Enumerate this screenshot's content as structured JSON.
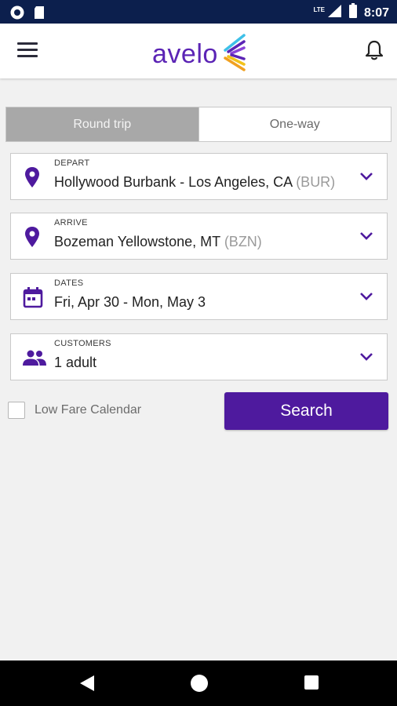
{
  "status_bar": {
    "time": "8:07",
    "network": "LTE",
    "icons": [
      "circle-notification-icon",
      "sd-card-icon",
      "signal-icon",
      "battery-icon"
    ]
  },
  "header": {
    "logo_text": "avelo",
    "icons": [
      "menu-icon",
      "bell-icon"
    ]
  },
  "trip_type": {
    "options": [
      "Round trip",
      "One-way"
    ],
    "selected": "Round trip"
  },
  "fields": {
    "depart": {
      "label": "DEPART",
      "value": "Hollywood Burbank - Los Angeles, CA",
      "code": "(BUR)",
      "icon": "location-pin-icon"
    },
    "arrive": {
      "label": "ARRIVE",
      "value": "Bozeman Yellowstone, MT",
      "code": "(BZN)",
      "icon": "location-pin-icon"
    },
    "dates": {
      "label": "DATES",
      "value": "Fri, Apr 30 - Mon, May 3",
      "icon": "calendar-icon"
    },
    "customers": {
      "label": "CUSTOMERS",
      "value": "1 adult",
      "icon": "people-icon"
    }
  },
  "low_fare": {
    "label": "Low Fare Calendar",
    "checked": false
  },
  "search_button": {
    "label": "Search"
  },
  "colors": {
    "brand_purple": "#4e1a9e",
    "logo_purple": "#5b24b5",
    "status_bar": "#0c1f4d"
  }
}
